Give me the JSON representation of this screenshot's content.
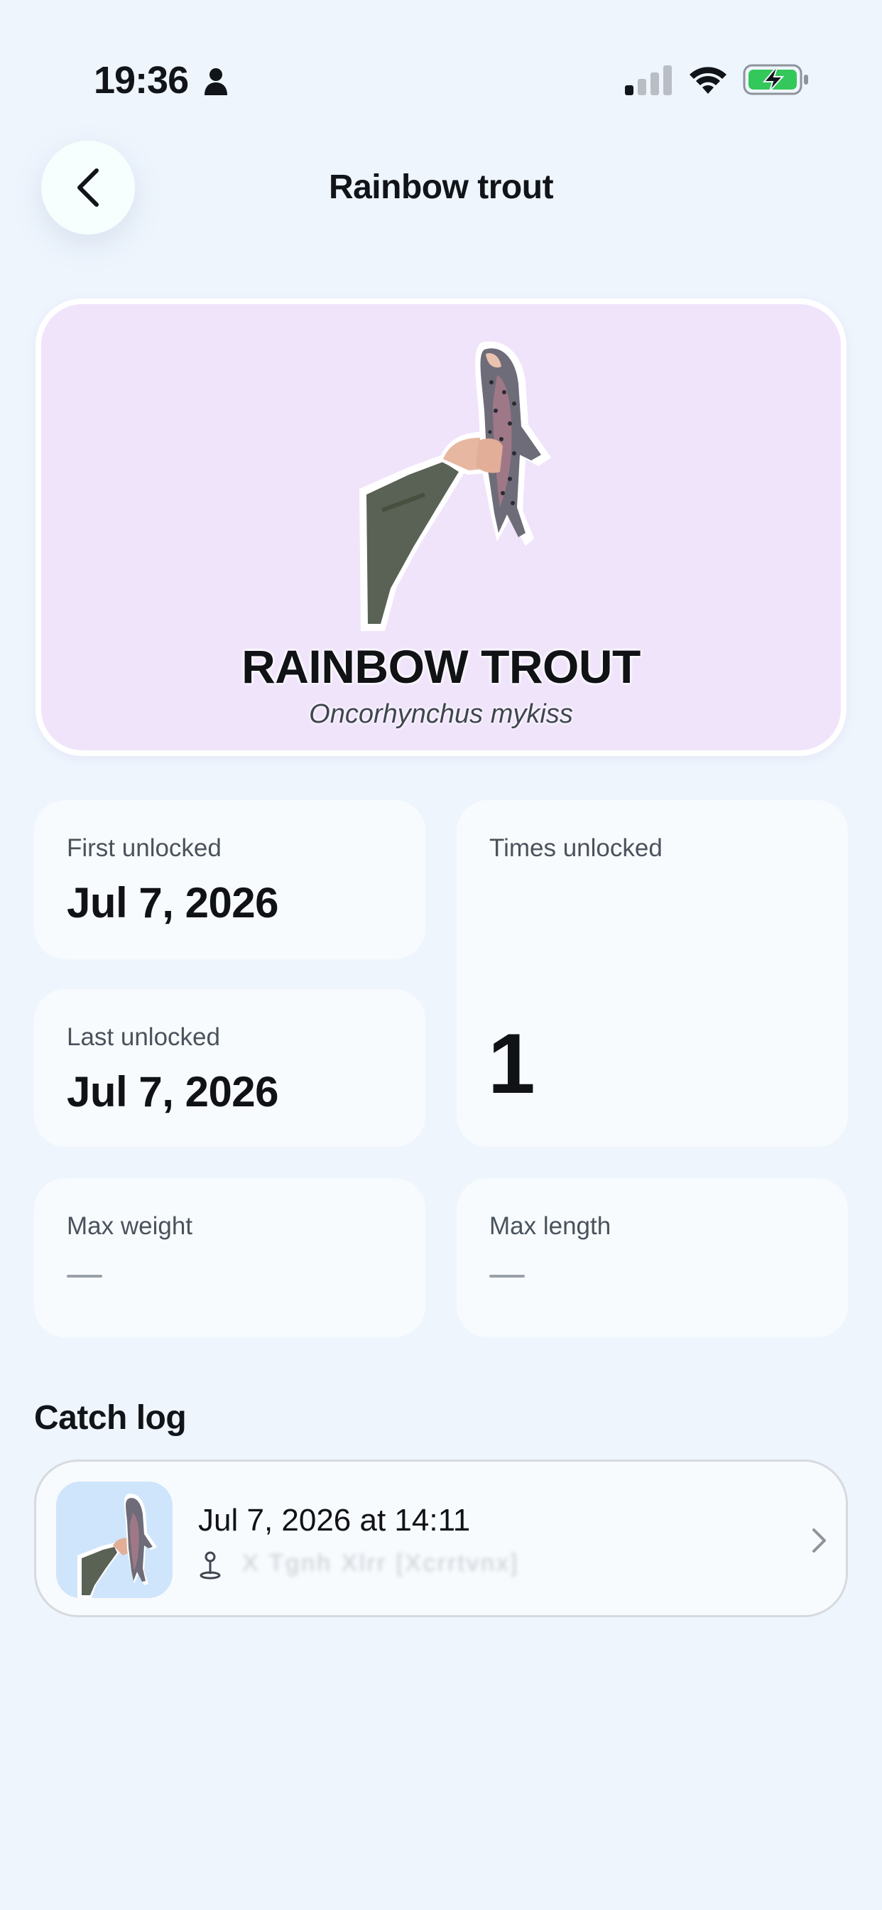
{
  "status_bar": {
    "time": "19:36",
    "icons": [
      "person-icon",
      "cellular-signal-icon",
      "wifi-icon",
      "battery-charging-icon"
    ]
  },
  "header": {
    "title": "Rainbow trout",
    "back_icon": "chevron-left-icon"
  },
  "hero": {
    "name": "RAINBOW TROUT",
    "scientific_name": "Oncorhynchus mykiss",
    "image": "rainbow-trout-catch-photo",
    "background": "#F0E4FB"
  },
  "stats": {
    "first_unlocked": {
      "label": "First unlocked",
      "value": "Jul 7, 2026"
    },
    "last_unlocked": {
      "label": "Last unlocked",
      "value": "Jul 7, 2026"
    },
    "times_unlocked": {
      "label": "Times unlocked",
      "value": "1"
    },
    "max_weight": {
      "label": "Max weight",
      "value": "—"
    },
    "max_length": {
      "label": "Max length",
      "value": "—"
    }
  },
  "catch_log": {
    "title": "Catch log",
    "entries": [
      {
        "datetime": "Jul 7, 2026 at 14:11",
        "location": "X Tgnh Xlrr [Xcrrtvnx]",
        "location_icon": "map-pin-icon",
        "thumbnail": "rainbow-trout-catch-thumbnail"
      }
    ]
  },
  "colors": {
    "background": "#EEF5FD",
    "card": "#F8FBFE",
    "battery_green": "#34C759"
  }
}
